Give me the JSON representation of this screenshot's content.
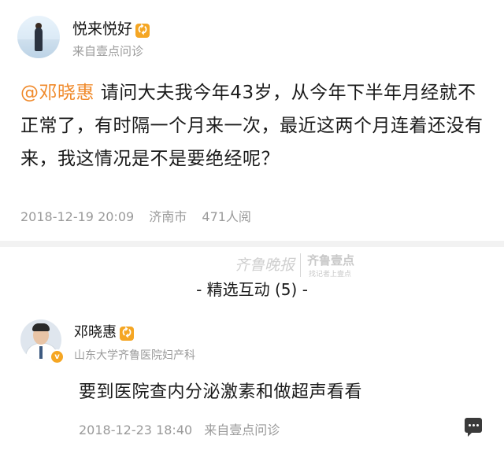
{
  "question_card": {
    "username": "悦来悦好",
    "badge": "🗘",
    "source": "来自壹点问诊",
    "mention": "@邓晓惠",
    "text": " 请问大夫我今年43岁，从今年下半年月经就不正常了，有时隔一个月来一次，最近这两个月连着还没有来，我这情况是不是要绝经呢？",
    "timestamp": "2018-12-19 20:09",
    "location": "济南市",
    "views": "471人阅"
  },
  "watermark": {
    "script_text": "齐鲁晚报",
    "brand": "齐鲁壹点",
    "slogan": "找记者上壹点"
  },
  "section": {
    "title": "- 精选互动 (5) -"
  },
  "answer_card": {
    "doctor_name": "邓晓惠",
    "badge": "🗘",
    "verify_badge": "v",
    "department": "山东大学齐鲁医院妇产科",
    "text": "要到医院查内分泌激素和做超声看看",
    "timestamp": "2018-12-23 18:40",
    "source": "来自壹点问诊"
  },
  "icons": {
    "reply": "comment-icon"
  },
  "colors": {
    "mention": "#f08a2b",
    "badge": "#f5a623",
    "meta_text": "#9a9a9a"
  }
}
